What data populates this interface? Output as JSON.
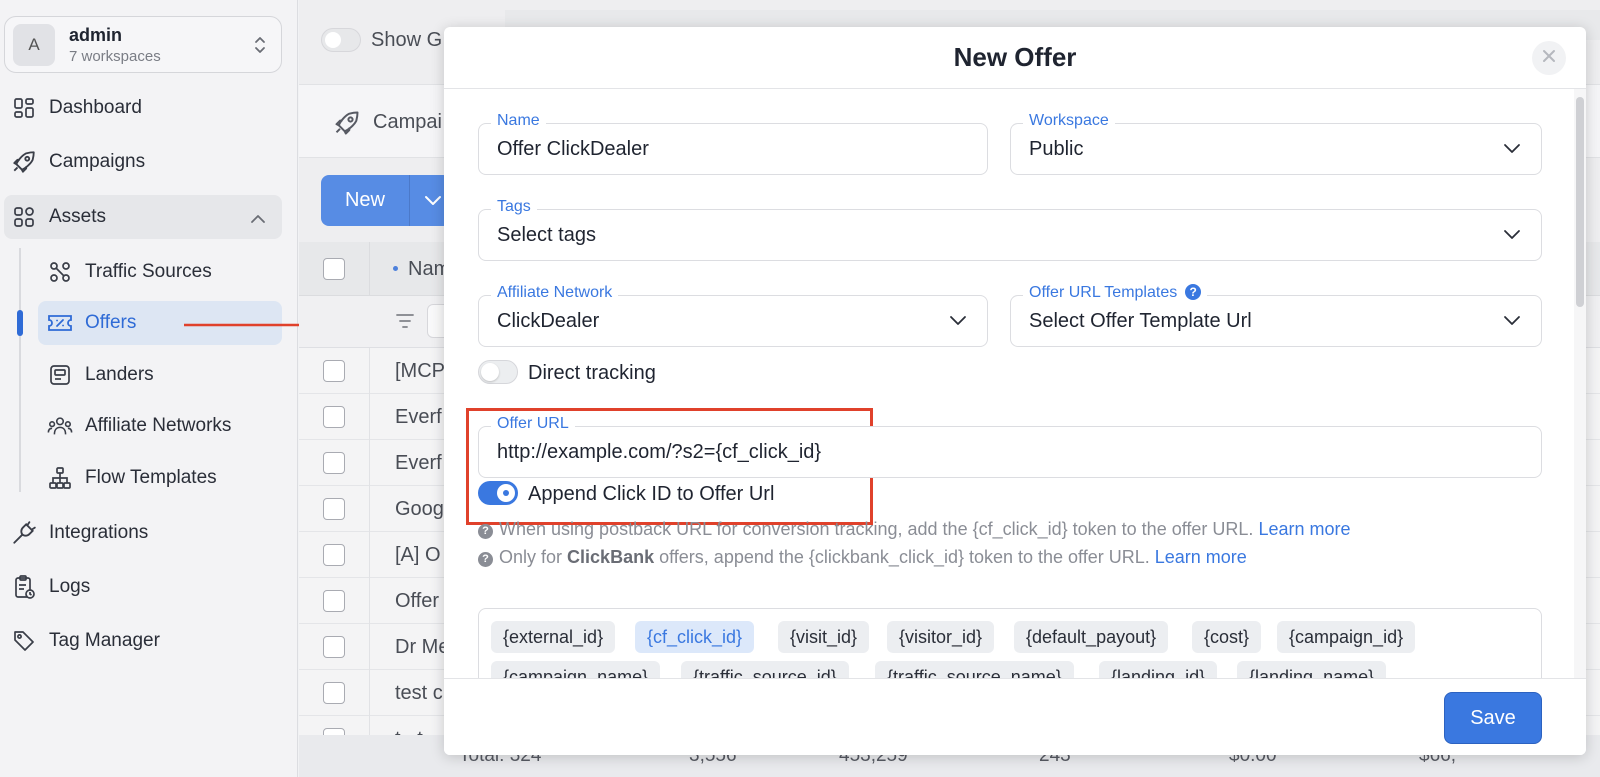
{
  "workspace": {
    "avatar": "A",
    "name": "admin",
    "count": "7 workspaces"
  },
  "sidebar": {
    "items": [
      {
        "label": "Dashboard",
        "icon": "dashboard-icon"
      },
      {
        "label": "Campaigns",
        "icon": "rocket-icon"
      },
      {
        "label": "Assets",
        "icon": "assets-icon"
      },
      {
        "label": "Traffic Sources",
        "icon": "traffic-sources-icon"
      },
      {
        "label": "Offers",
        "icon": "ticket-icon"
      },
      {
        "label": "Landers",
        "icon": "lander-icon"
      },
      {
        "label": "Affiliate Networks",
        "icon": "people-icon"
      },
      {
        "label": "Flow Templates",
        "icon": "flow-icon"
      },
      {
        "label": "Integrations",
        "icon": "plug-icon"
      },
      {
        "label": "Logs",
        "icon": "clipboard-icon"
      },
      {
        "label": "Tag Manager",
        "icon": "tag-icon"
      }
    ]
  },
  "background": {
    "show_toggle_label": "Show G",
    "campaign_tab": "Campai",
    "new_button": "New",
    "name_header": "Nam",
    "rows": [
      "[MCP",
      "Everf",
      "Everf",
      "Goog",
      "[A] O",
      "Offer",
      "Dr Me",
      "test c",
      "t...t"
    ],
    "total_cells": [
      "Total: 324",
      "3,556",
      "453,259",
      "243",
      "$0.00",
      "$66,"
    ]
  },
  "modal": {
    "title": "New Offer",
    "name": {
      "label": "Name",
      "value": "Offer ClickDealer"
    },
    "workspace": {
      "label": "Workspace",
      "value": "Public"
    },
    "tags": {
      "label": "Tags",
      "placeholder": "Select tags"
    },
    "affiliate_network": {
      "label": "Affiliate Network",
      "value": "ClickDealer"
    },
    "offer_url_templates": {
      "label": "Offer URL Templates",
      "placeholder": "Select Offer Template Url"
    },
    "direct_tracking": {
      "label": "Direct tracking",
      "enabled": false
    },
    "offer_url": {
      "label": "Offer URL",
      "value": "http://example.com/?s2={cf_click_id}"
    },
    "append_click_id": {
      "label": "Append Click ID to Offer Url",
      "enabled": true
    },
    "hint1": {
      "text": "When using postback URL for conversion tracking, add the {cf_click_id} token to the offer URL.",
      "link": "Learn more"
    },
    "hint2": {
      "prefix": "Only for",
      "bold": "ClickBank",
      "text": "offers, append the {clickbank_click_id} token to the offer URL.",
      "link": "Learn more"
    },
    "tokens": [
      "{external_id}",
      "{cf_click_id}",
      "{visit_id}",
      "{visitor_id}",
      "{default_payout}",
      "{cost}",
      "{campaign_id}",
      "{campaign_name}",
      "{traffic_source_id}",
      "{traffic_source_name}",
      "{landing_id}",
      "{landing_name}"
    ],
    "active_token": "{cf_click_id}",
    "save_label": "Save"
  },
  "colors": {
    "accent": "#3a78e0",
    "highlight": "#e0412b"
  }
}
